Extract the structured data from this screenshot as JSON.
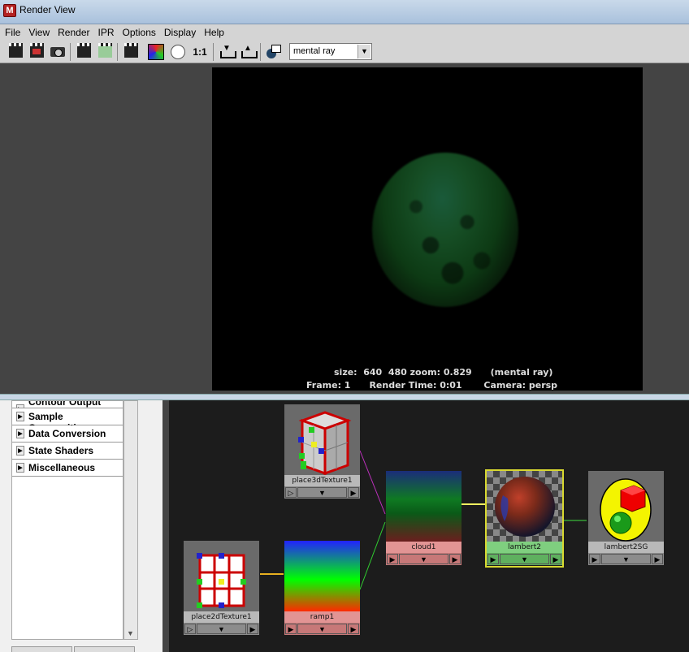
{
  "window": {
    "title": "Render View"
  },
  "menu": [
    "File",
    "View",
    "Render",
    "IPR",
    "Options",
    "Display",
    "Help"
  ],
  "toolbar": {
    "icons": [
      "redo-render-icon",
      "ipr-render-icon",
      "snapshot-icon",
      "render-region-icon",
      "ipr-region-icon",
      "render-sequence-icon",
      "rgb-channels-icon",
      "alpha-channel-icon",
      "real-size-icon",
      "keep-image-icon",
      "remove-image-icon",
      "display-in-hypershade-icon"
    ],
    "real_size_label": "1:1",
    "renderer": "mental ray"
  },
  "render": {
    "info_size": "size:  640  480 zoom: 0.829      (mental ray)",
    "info_frame": "Frame: 1      Render Time: 0:01       Camera: persp",
    "colors": {
      "background": "#000000",
      "sphere": "#1a5a2a"
    }
  },
  "left_panel": {
    "sections": [
      "Contour Output",
      "Sample Compositing",
      "Data Conversion",
      "State Shaders",
      "Miscellaneous"
    ]
  },
  "hypershade": {
    "nodes": [
      {
        "name": "place3dTexture1"
      },
      {
        "name": "cloud1"
      },
      {
        "name": "lambert2"
      },
      {
        "name": "lambert2SG"
      },
      {
        "name": "place2dTexture1"
      },
      {
        "name": "ramp1"
      }
    ]
  }
}
